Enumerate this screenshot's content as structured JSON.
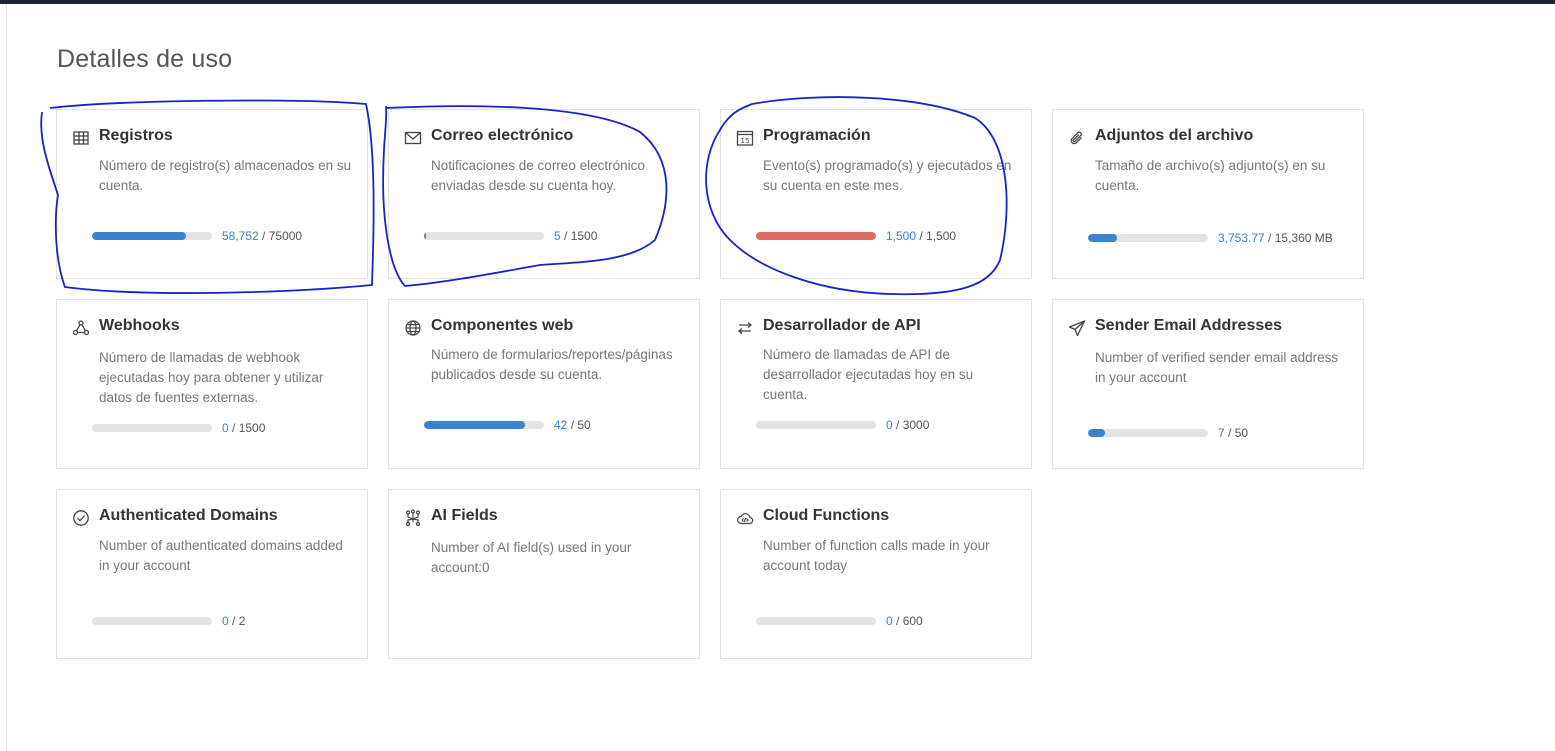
{
  "page": {
    "title": "Detalles de uso"
  },
  "cards": [
    {
      "icon": "table-icon",
      "title": "Registros",
      "desc": "Número de registro(s) almacenados en su cuenta.",
      "used": "58,752",
      "limit": "75000",
      "fill": 0.78,
      "color": "#3b82d1"
    },
    {
      "icon": "mail-icon",
      "title": "Correo electrónico",
      "desc": "Notificaciones de correo electrónico enviadas desde su cuenta hoy.",
      "used": "5",
      "limit": "1500",
      "fill": 0.0033,
      "color": "#3b82d1"
    },
    {
      "icon": "calendar-icon",
      "title": "Programación",
      "desc": "Evento(s) programado(s) y ejecutados en su cuenta en este mes.",
      "used": "1,500",
      "limit": "1,500",
      "fill": 1.0,
      "color": "#e06b63"
    },
    {
      "icon": "paperclip-icon",
      "title": "Adjuntos del archivo",
      "desc": "Tamaño de archivo(s) adjunto(s) en su cuenta.",
      "used": "3,753.77",
      "limit": "15,360 MB",
      "fill": 0.244,
      "color": "#3b82d1"
    },
    {
      "icon": "webhook-icon",
      "title": "Webhooks",
      "desc": "Número de llamadas de webhook ejecutadas hoy para obtener y utilizar datos de fuentes externas.",
      "used": "0",
      "limit": "1500",
      "fill": 0,
      "color": "#3b82d1"
    },
    {
      "icon": "globe-icon",
      "title": "Componentes web",
      "desc": "Número de formularios/reportes/páginas publicados desde su cuenta.",
      "used": "42",
      "limit": "50",
      "fill": 0.84,
      "color": "#3b82d1"
    },
    {
      "icon": "api-arrows-icon",
      "title": "Desarrollador de API",
      "desc": "Número de llamadas de API de desarrollador ejecutadas hoy en su cuenta.",
      "used": "0",
      "limit": "3000",
      "fill": 0,
      "color": "#3b82d1"
    },
    {
      "icon": "paper-plane-icon",
      "title": "Sender Email Addresses",
      "desc": "Number of verified sender email address in your account",
      "used": "7",
      "limit": "50",
      "fill": 0.14,
      "color": "#3b82d1"
    },
    {
      "icon": "check-circle-icon",
      "title": "Authenticated Domains",
      "desc": "Number of authenticated domains added in your account",
      "used": "0",
      "limit": "2",
      "fill": 0,
      "color": "#3b82d1"
    },
    {
      "icon": "ai-circuit-icon",
      "title": "AI Fields",
      "desc": "Number of AI field(s) used in your account:0"
    },
    {
      "icon": "cloud-code-icon",
      "title": "Cloud Functions",
      "desc": "Number of function calls made in your account today",
      "used": "0",
      "limit": "600",
      "fill": 0,
      "color": "#3b82d1"
    }
  ]
}
